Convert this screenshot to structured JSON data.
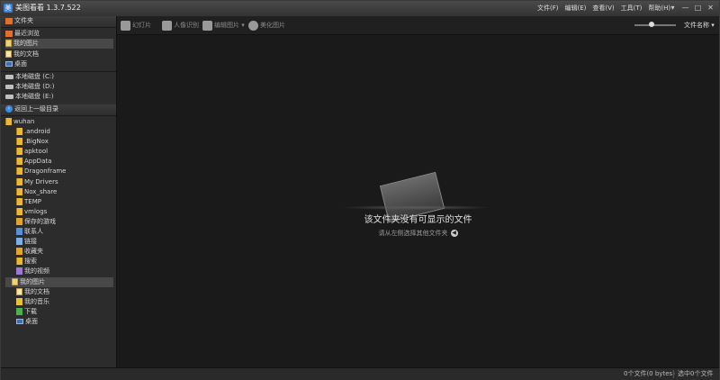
{
  "app": {
    "title": "美图看看 1.3.7.522",
    "icon_glyph": "美"
  },
  "menu": [
    "文件(F)",
    "编辑(E)",
    "查看(V)",
    "工具(T)",
    "帮助(H)"
  ],
  "window_controls": [
    "▾",
    "—",
    "□",
    "✕"
  ],
  "sidebar": {
    "header": "文件夹",
    "quick": [
      {
        "label": "最近浏览",
        "icon": "home-icon"
      },
      {
        "label": "我的图片",
        "icon": "pictures-icon",
        "selected": true
      },
      {
        "label": "我的文档",
        "icon": "documents-icon"
      },
      {
        "label": "桌面",
        "icon": "desktop-icon"
      }
    ],
    "drives": [
      "本地磁盘 (C:)",
      "本地磁盘 (D:)",
      "本地磁盘 (E:)"
    ],
    "back_label": "返回上一级目录",
    "tree_root": "wuhan",
    "tree_items": [
      {
        "label": ".android",
        "icon": "folder-icon"
      },
      {
        "label": ".BigNox",
        "icon": "folder-icon"
      },
      {
        "label": "apktool",
        "icon": "folder-icon"
      },
      {
        "label": "AppData",
        "icon": "folder-icon"
      },
      {
        "label": "Dragonframe",
        "icon": "folder-icon"
      },
      {
        "label": "My Drivers",
        "icon": "folder-icon"
      },
      {
        "label": "Nox_share",
        "icon": "folder-icon"
      },
      {
        "label": "TEMP",
        "icon": "folder-icon"
      },
      {
        "label": "vmlogs",
        "icon": "folder-icon"
      },
      {
        "label": "保存的游戏",
        "icon": "saved-games-icon"
      },
      {
        "label": "联系人",
        "icon": "contacts-icon"
      },
      {
        "label": "链接",
        "icon": "links-icon"
      },
      {
        "label": "收藏夹",
        "icon": "favorites-icon"
      },
      {
        "label": "搜索",
        "icon": "search-icon"
      },
      {
        "label": "我的视频",
        "icon": "videos-icon"
      },
      {
        "label": "我的图片",
        "icon": "pictures-icon",
        "selected": true
      },
      {
        "label": "我的文档",
        "icon": "documents-icon"
      },
      {
        "label": "我的音乐",
        "icon": "music-icon"
      },
      {
        "label": "下载",
        "icon": "downloads-icon"
      },
      {
        "label": "桌面",
        "icon": "desktop-icon"
      }
    ]
  },
  "toolbar": {
    "buttons": [
      "幻灯片",
      "人像识别",
      "编辑图片",
      "美化图片"
    ],
    "dropdown_arrow": "▾",
    "sort_label": "文件名称",
    "sort_arrow": "▾"
  },
  "empty_state": {
    "title": "该文件夹没有可显示的文件",
    "subtitle": "请从左侧选择其他文件夹",
    "hint_arrow": "◀"
  },
  "status": {
    "file_count": "0个文件(0 bytes)",
    "selected": "选中0个文件"
  }
}
